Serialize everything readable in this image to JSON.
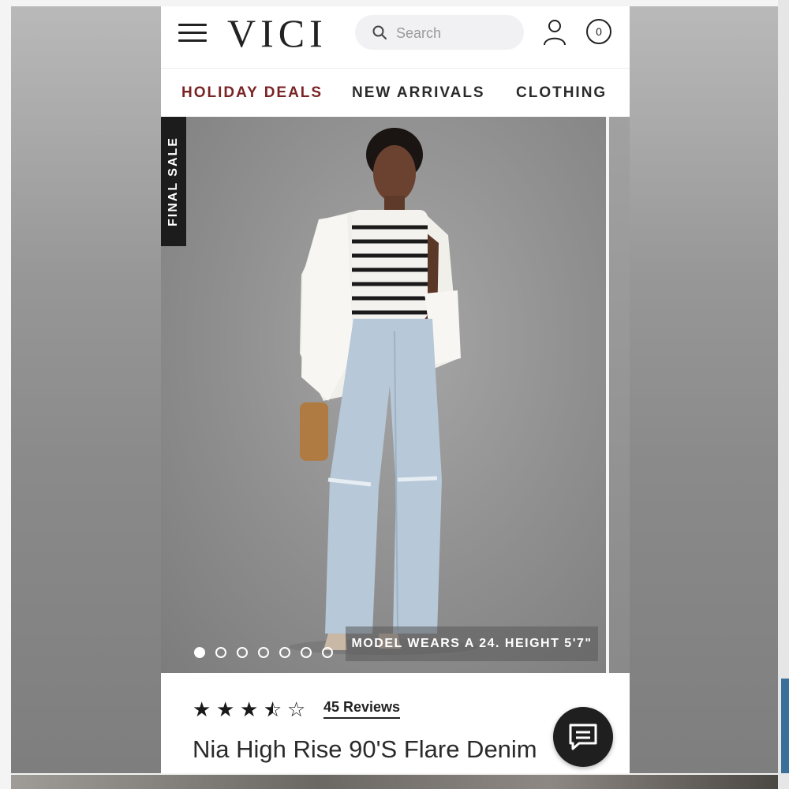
{
  "header": {
    "logo": "VICI",
    "search_placeholder": "Search",
    "cart_count": "0",
    "icons": [
      "menu-icon",
      "search-icon",
      "user-icon",
      "cart-icon"
    ]
  },
  "nav": {
    "items": [
      "HOLIDAY DEALS",
      "NEW ARRIVALS",
      "CLOTHING"
    ],
    "accent_color": "#7a2325"
  },
  "gallery": {
    "badge": "FINAL SALE",
    "model_note": "MODEL WEARS A 24. HEIGHT 5'7\"",
    "dot_count": 7,
    "active_dot": 1
  },
  "product": {
    "rating": 3.5,
    "rating_max": 5,
    "reviews_label": "45 Reviews",
    "title": "Nia High Rise 90'S Flare Denim"
  },
  "chat": {
    "icon": "chat-bubble-icon"
  }
}
